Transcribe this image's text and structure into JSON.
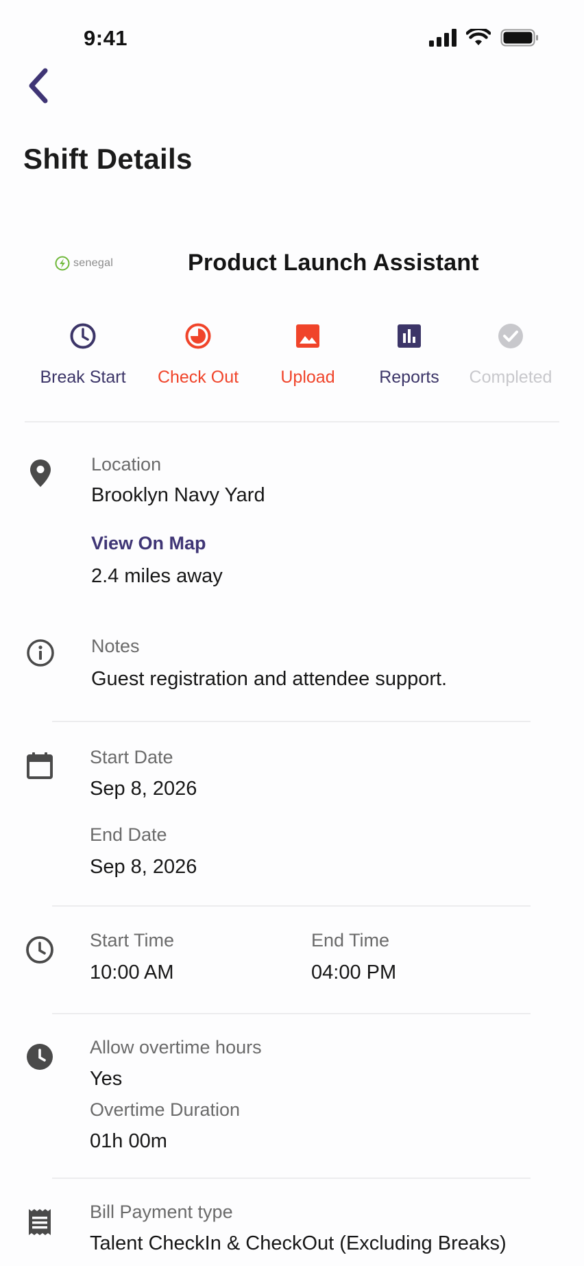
{
  "status_bar": {
    "time": "9:41"
  },
  "header": {
    "title": "Shift Details"
  },
  "job": {
    "brand": "senegal",
    "title": "Product Launch Assistant"
  },
  "actions": [
    {
      "label": "Break Start",
      "color": "#3c3568",
      "icon": "clock-icon"
    },
    {
      "label": "Check Out",
      "color": "#f0442a",
      "icon": "timer-icon"
    },
    {
      "label": "Upload",
      "color": "#f0442a",
      "icon": "image-icon"
    },
    {
      "label": "Reports",
      "color": "#3c3568",
      "icon": "bar-chart-icon"
    },
    {
      "label": "Completed",
      "color": "#c8c8cc",
      "icon": "check-circle-icon"
    }
  ],
  "location": {
    "label": "Location",
    "value": "Brooklyn Navy Yard",
    "map_link": "View On Map",
    "distance": "2.4 miles away"
  },
  "notes": {
    "label": "Notes",
    "value": "Guest registration and attendee support."
  },
  "dates": {
    "start_label": "Start Date",
    "start_value": "Sep 8, 2026",
    "end_label": "End Date",
    "end_value": "Sep 8, 2026"
  },
  "times": {
    "start_label": "Start Time",
    "start_value": "10:00 AM",
    "end_label": "End Time",
    "end_value": "04:00 PM"
  },
  "overtime": {
    "allow_label": "Allow overtime hours",
    "allow_value": "Yes",
    "duration_label": "Overtime Duration",
    "duration_value": "01h 00m"
  },
  "billing": {
    "label": "Bill Payment type",
    "value": "Talent CheckIn & CheckOut (Excluding Breaks)"
  }
}
